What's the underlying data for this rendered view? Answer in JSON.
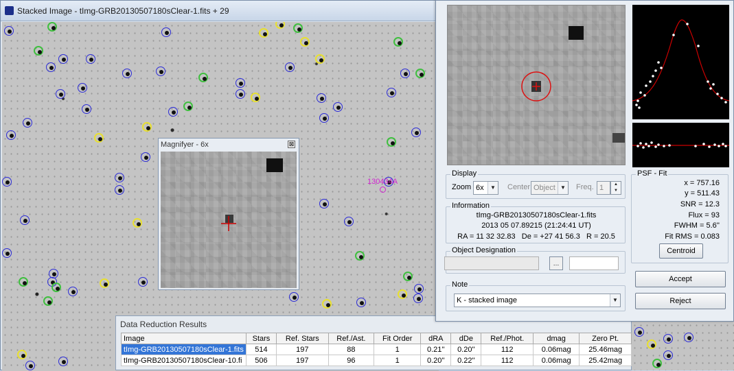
{
  "main_window": {
    "title": "Stacked Image - tImg-GRB20130507180sClear-1.fits + 29",
    "comet_label": "130434A"
  },
  "magnifyer": {
    "title": "Magnifyer - 6x",
    "close_glyph": "⊠"
  },
  "data_results": {
    "title": "Data Reduction Results",
    "columns": [
      "Image",
      "Stars",
      "Ref. Stars",
      "Ref./Ast.",
      "Fit Order",
      "dRA",
      "dDe",
      "Ref./Phot.",
      "dmag",
      "Zero Pt."
    ],
    "rows": [
      [
        "tImg-GRB20130507180sClear-1.fits",
        "514",
        "197",
        "88",
        "1",
        "0.21''",
        "0.20''",
        "112",
        "0.06mag",
        "25.46mag"
      ],
      [
        "tImg-GRB20130507180sClear-10.fi",
        "506",
        "197",
        "96",
        "1",
        "0.20''",
        "0.22''",
        "112",
        "0.06mag",
        "25.42mag"
      ]
    ],
    "selected_row": 0
  },
  "display": {
    "group_label": "Display",
    "zoom_label": "Zoom",
    "zoom_value": "6x",
    "center_label": "Center",
    "center_value": "Object",
    "freq_label": "Freq.",
    "freq_value": "1"
  },
  "information": {
    "group_label": "Information",
    "filename": "tImg-GRB20130507180sClear-1.fits",
    "datetime": "2013 05 07.89215 (21:24:41 UT)",
    "coords": "RA = 11 32 32.83   De = +27 41 56.3   R = 20.5"
  },
  "object_designation": {
    "group_label": "Object Designation",
    "button_glyph": "…"
  },
  "note": {
    "group_label": "Note",
    "value": "K - stacked image"
  },
  "psf_fit": {
    "group_label": "PSF - Fit",
    "x": "x = 757.16",
    "y": "y = 511.43",
    "snr": "SNR = 12.3",
    "flux": "Flux = 93",
    "fwhm": "FWHM = 5.6''",
    "fit_rms": "Fit RMS = 0.083",
    "centroid_button": "Centroid"
  },
  "actions": {
    "accept": "Accept",
    "reject": "Reject"
  },
  "colors": {
    "ring_blue": "#2b2bd8",
    "ring_green": "#3fbf3f",
    "ring_yellow": "#e8e030",
    "comet_magenta": "#d020d0",
    "psf_curve": "#cc0000",
    "selection": "#3375d7"
  }
}
